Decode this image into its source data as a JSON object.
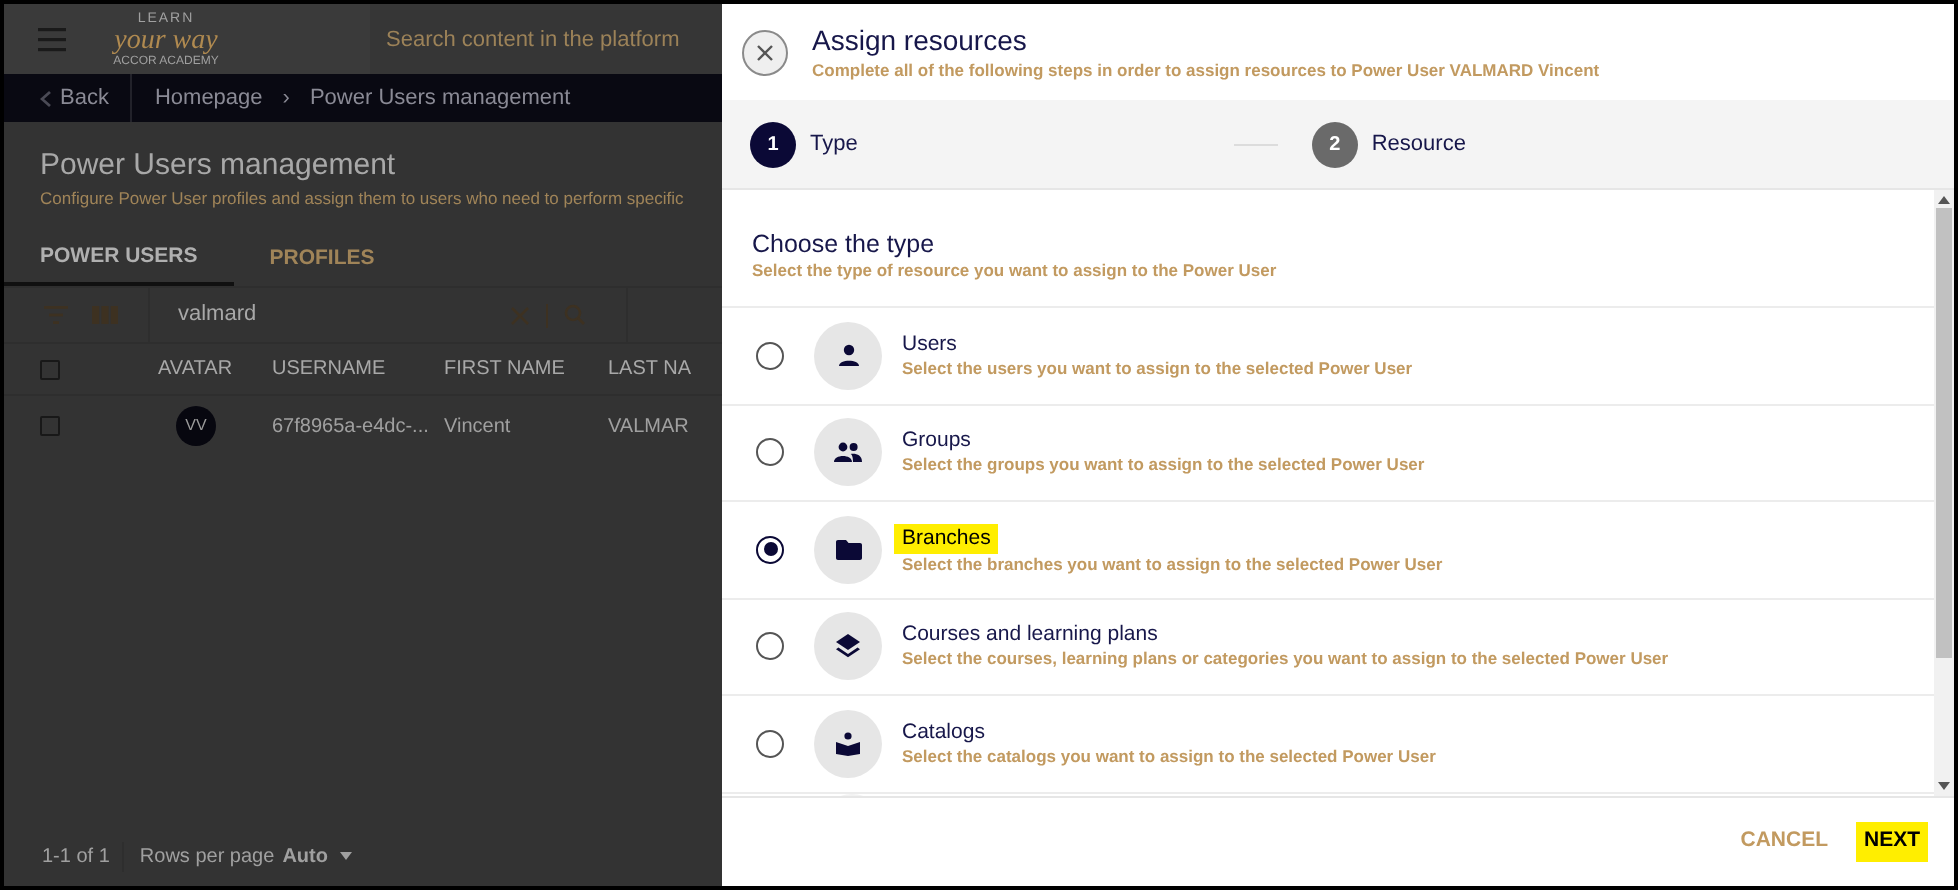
{
  "background": {
    "logo": {
      "top": "LEARN",
      "script": "your way",
      "bottom": "ACCOR ACADEMY"
    },
    "search": {
      "placeholder": "Search content in the platform"
    },
    "breadcrumb": {
      "back": "Back",
      "items": [
        "Homepage",
        "Power Users management"
      ],
      "separator": "›"
    },
    "title": "Power Users management",
    "subtitle": "Configure Power User profiles and assign them to users who need to perform specific",
    "tabs": [
      {
        "label": "POWER USERS",
        "selected": true
      },
      {
        "label": "PROFILES",
        "selected": false
      }
    ],
    "filter": {
      "value": "valmard"
    },
    "table": {
      "header_checked": false,
      "columns": [
        "AVATAR",
        "USERNAME",
        "FIRST NAME",
        "LAST NA"
      ],
      "rows": [
        {
          "checked": false,
          "avatar": "VV",
          "username": "67f8965a-e4dc-...",
          "first_name": "Vincent",
          "last_name": "VALMAR"
        }
      ]
    },
    "footer": {
      "range": "1-1 of 1",
      "rows_label": "Rows per page",
      "rows_value": "Auto"
    }
  },
  "dialog": {
    "title": "Assign resources",
    "subtitle": "Complete all of the following steps in order to assign resources to Power User VALMARD Vincent",
    "steps": [
      {
        "number": "1",
        "label": "Type",
        "selected": true
      },
      {
        "number": "2",
        "label": "Resource",
        "selected": false
      }
    ],
    "section_title": "Choose the type",
    "section_subtitle": "Select the type of resource you want to assign to the Power User",
    "options": [
      {
        "kind": "user",
        "title": "Users",
        "description": "Select the users you want to assign to the selected Power User",
        "selected": false,
        "highlighted": false
      },
      {
        "kind": "group",
        "title": "Groups",
        "description": "Select the groups you want to assign to the selected Power User",
        "selected": false,
        "highlighted": false
      },
      {
        "kind": "folder",
        "title": "Branches",
        "description": "Select the branches you want to assign to the selected Power User",
        "selected": true,
        "highlighted": true
      },
      {
        "kind": "layers",
        "title": "Courses and learning plans",
        "description": "Select the courses, learning plans or categories you want to assign to the selected Power User",
        "selected": false,
        "highlighted": false
      },
      {
        "kind": "book",
        "title": "Catalogs",
        "description": "Select the catalogs you want to assign to the selected Power User",
        "selected": false,
        "highlighted": false
      }
    ],
    "buttons": [
      {
        "label": "CANCEL",
        "highlighted": false
      },
      {
        "label": "NEXT",
        "highlighted": true
      }
    ]
  }
}
